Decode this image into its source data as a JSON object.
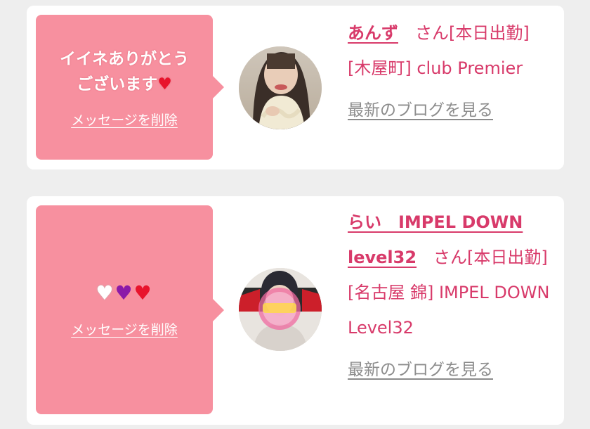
{
  "cards": [
    {
      "message_line1": "イイネありがとう",
      "message_line2": "ございます",
      "heart": "♥",
      "delete_label": "メッセージを削除",
      "avatar_icon": "woman-portrait-avatar",
      "name": "あんず",
      "name_suffix": "　さん[本日出勤]",
      "location": "[木屋町] club Premier",
      "blog_label": "最新のブログを見る"
    },
    {
      "hearts": [
        "♥",
        "♥",
        "♥"
      ],
      "heart_colors": [
        "#ffffff",
        "#8b1aa8",
        "#e8142c"
      ],
      "delete_label": "メッセージを削除",
      "avatar_icon": "woman-portrait-avatar",
      "name": "らい　IMPEL DOWN level32",
      "name_suffix": "　さん[本日出勤]",
      "location": "[名古屋 錦] IMPEL DOWN Level32",
      "blog_label": "最新のブログを見る"
    }
  ],
  "colors": {
    "bubble": "#f7909f",
    "accent_text": "#d83a6a",
    "muted_link": "#8c8c8c",
    "card_bg": "#ffffff",
    "page_bg": "#eeeeee"
  }
}
